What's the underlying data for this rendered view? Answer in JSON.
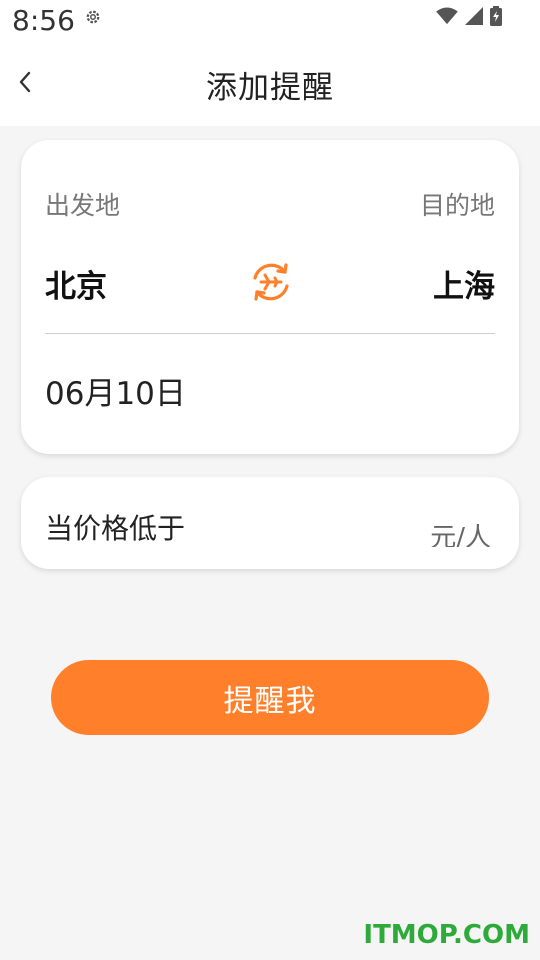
{
  "status_bar": {
    "time": "8:56",
    "icons": [
      "gear-icon",
      "wifi-icon",
      "signal-icon",
      "battery-icon"
    ]
  },
  "header": {
    "title": "添加提醒",
    "back_icon": "chevron-left-icon"
  },
  "route": {
    "origin_label": "出发地",
    "destination_label": "目的地",
    "origin_city": "北京",
    "destination_city": "上海",
    "swap_icon": "swap-flight-icon",
    "date": "06月10日"
  },
  "price": {
    "label": "当价格低于",
    "value": "",
    "placeholder": "",
    "unit": "元/人"
  },
  "actions": {
    "remind_label": "提醒我"
  },
  "watermark": {
    "text": "ITMOP.COM"
  },
  "colors": {
    "accent": "#ff7f2a",
    "background": "#f5f5f5",
    "card": "#ffffff",
    "watermark": "#2eaa3b"
  }
}
